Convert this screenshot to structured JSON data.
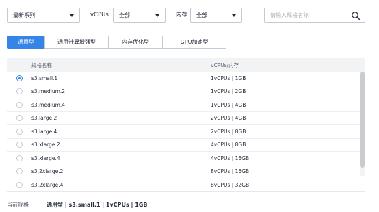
{
  "filters": {
    "series": {
      "value": "最新系列"
    },
    "vcpus": {
      "label": "vCPUs",
      "value": "全部"
    },
    "memory": {
      "label": "内存",
      "value": "全部"
    },
    "search": {
      "placeholder": "请输入规格名称"
    }
  },
  "tabs": [
    {
      "label": "通用型",
      "active": true
    },
    {
      "label": "通用计算增强型",
      "active": false
    },
    {
      "label": "内存优化型",
      "active": false
    },
    {
      "label": "GPU加速型",
      "active": false
    }
  ],
  "table": {
    "columns": {
      "name": "规格名称",
      "spec": "vCPUs/内存"
    },
    "rows": [
      {
        "name": "s3.small.1",
        "spec": "1vCPUs | 1GB",
        "selected": true
      },
      {
        "name": "s3.medium.2",
        "spec": "1vCPUs | 2GB",
        "selected": false
      },
      {
        "name": "s3.medium.4",
        "spec": "1vCPUs | 4GB",
        "selected": false
      },
      {
        "name": "s3.large.2",
        "spec": "2vCPUs | 4GB",
        "selected": false
      },
      {
        "name": "s3.large.4",
        "spec": "2vCPUs | 8GB",
        "selected": false
      },
      {
        "name": "s3.xlarge.2",
        "spec": "4vCPUs | 8GB",
        "selected": false
      },
      {
        "name": "s3.xlarge.4",
        "spec": "4vCPUs | 16GB",
        "selected": false
      },
      {
        "name": "s3.2xlarge.2",
        "spec": "8vCPUs | 16GB",
        "selected": false
      },
      {
        "name": "s3.2xlarge.4",
        "spec": "8vCPUs | 32GB",
        "selected": false
      }
    ]
  },
  "current_spec": {
    "label": "当前规格",
    "value": "通用型 | s3.small.1 | 1vCPUs | 1GB"
  },
  "colors": {
    "accent": "#3584e8",
    "border": "#c5c9d1",
    "header_bg": "#f2f3f5"
  }
}
